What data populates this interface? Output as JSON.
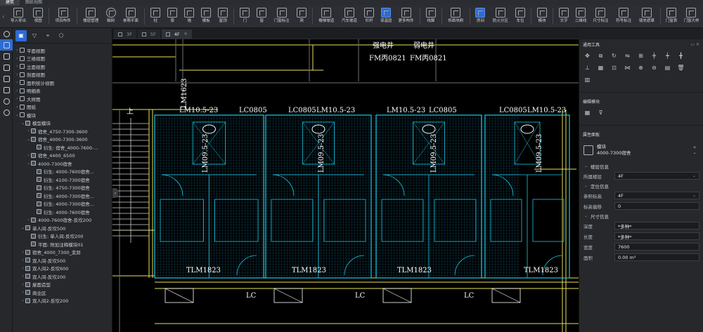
{
  "ribbon": {
    "tabs": [
      "建筑",
      "图纸视图"
    ],
    "groups": [
      [
        {
          "label": "导入导出",
          "icon": "import-export-icon",
          "wide": true
        },
        {
          "label": "视图",
          "icon": "view-icon"
        }
      ],
      [
        {
          "label": "项目构件",
          "icon": "project-component-icon",
          "wide": true
        }
      ],
      [
        {
          "label": "楼层管理",
          "icon": "floor-manage-icon",
          "wide": true
        },
        {
          "label": "轴网",
          "icon": "axis-grid-icon",
          "round": true
        },
        {
          "label": "参照平面",
          "icon": "reference-plane-icon",
          "wide": true
        }
      ],
      [
        {
          "label": "柱",
          "icon": "column-icon"
        },
        {
          "label": "梁",
          "icon": "beam-icon"
        },
        {
          "label": "墙",
          "icon": "wall-icon"
        },
        {
          "label": "楼板",
          "icon": "slab-icon"
        },
        {
          "label": "屋顶",
          "icon": "roof-icon"
        }
      ],
      [
        {
          "label": "门",
          "icon": "door-icon"
        },
        {
          "label": "窗",
          "icon": "window-icon"
        },
        {
          "label": "门窗标注",
          "icon": "door-window-tag-icon",
          "wide": true
        },
        {
          "label": "洞",
          "icon": "opening-icon"
        }
      ],
      [
        {
          "label": "楼梯坡道",
          "icon": "stair-ramp-icon",
          "wide": true
        },
        {
          "label": "汽车坡道",
          "icon": "car-ramp-icon",
          "wide": true
        },
        {
          "label": "栏杆",
          "icon": "railing-icon"
        },
        {
          "label": "保温层",
          "icon": "insulation-icon",
          "blue": true
        },
        {
          "label": "更多构件",
          "icon": "more-components-icon",
          "wide": true
        }
      ],
      [
        {
          "label": "线脚",
          "icon": "molding-icon"
        }
      ],
      [
        {
          "label": "饰面块刷",
          "icon": "finish-brush-icon",
          "wide": true
        }
      ],
      [
        {
          "label": "房间",
          "icon": "room-icon",
          "blue": true
        },
        {
          "label": "防火分区",
          "icon": "fire-zone-icon",
          "wide": true
        },
        {
          "label": "车位",
          "icon": "parking-icon"
        }
      ],
      [
        {
          "label": "模块",
          "icon": "module-icon"
        }
      ],
      [
        {
          "label": "文字",
          "icon": "text-icon"
        },
        {
          "label": "二维线",
          "icon": "2d-line-icon"
        },
        {
          "label": "尺寸标注",
          "icon": "dimension-icon",
          "wide": true
        },
        {
          "label": "符号标注",
          "icon": "symbol-tag-icon",
          "wide": true
        },
        {
          "label": "填充遮罩",
          "icon": "fill-mask-icon",
          "wide": true
        }
      ],
      [
        {
          "label": "门窗表",
          "icon": "door-window-table-icon"
        },
        {
          "label": "门窗大样",
          "icon": "door-window-detail-icon",
          "wide": true
        }
      ]
    ]
  },
  "left_panel": {
    "tools": [
      "panel-icon",
      "filter-icon",
      "locate-icon",
      "settings-icon"
    ],
    "tree": [
      {
        "d": 0,
        "t": "平面视图",
        "tw": "›"
      },
      {
        "d": 0,
        "t": "三维视图",
        "tw": "›"
      },
      {
        "d": 0,
        "t": "立面视图",
        "tw": "›"
      },
      {
        "d": 0,
        "t": "剖面视图",
        "tw": "›"
      },
      {
        "d": 0,
        "t": "面积统计视图",
        "tw": "›"
      },
      {
        "d": 0,
        "t": "明细表",
        "tw": "›"
      },
      {
        "d": 0,
        "t": "大样图",
        "tw": "›"
      },
      {
        "d": 0,
        "t": "图纸",
        "tw": "›"
      },
      {
        "d": 0,
        "t": "模块",
        "tw": "⌄"
      },
      {
        "d": 1,
        "t": "模型模块",
        "tw": "⌄"
      },
      {
        "d": 2,
        "t": "宿舍_4750-7300-3600",
        "tw": "›"
      },
      {
        "d": 2,
        "t": "宿舍_4000-7300-3600",
        "tw": "⌄"
      },
      {
        "d": 3,
        "t": "衍生: 宿舍_4000-7600-...",
        "tw": ""
      },
      {
        "d": 2,
        "t": "宿舍_4400_6500",
        "tw": "›"
      },
      {
        "d": 2,
        "t": "4000-7300宿舍",
        "tw": "⌄"
      },
      {
        "d": 3,
        "t": "衍生: 4000-7600宿舍...",
        "tw": ""
      },
      {
        "d": 3,
        "t": "衍生: 4100-7300宿舍",
        "tw": ""
      },
      {
        "d": 3,
        "t": "衍生: 4750-7300宿舍",
        "tw": ""
      },
      {
        "d": 3,
        "t": "衍生: 4000-7300宿舍...",
        "tw": ""
      },
      {
        "d": 3,
        "t": "衍生: 4000-7300宿舍...",
        "tw": ""
      },
      {
        "d": 3,
        "t": "衍生: 4000-7600宿舍",
        "tw": ""
      },
      {
        "d": 2,
        "t": "4000-7600宿舍-反坎200",
        "tw": "›"
      },
      {
        "d": 1,
        "t": "单人间-反坎500",
        "tw": "⌄"
      },
      {
        "d": 2,
        "t": "衍生: 单人间-反坎200",
        "tw": ""
      },
      {
        "d": 2,
        "t": "平面: 附加注释模块01",
        "tw": ""
      },
      {
        "d": 1,
        "t": "宿舍_4000_7300_变异",
        "tw": "›"
      },
      {
        "d": 1,
        "t": "双人间-反坎500",
        "tw": "›"
      },
      {
        "d": 1,
        "t": "双人间2-反坎600",
        "tw": "›"
      },
      {
        "d": 1,
        "t": "双人间-反坎200",
        "tw": "›"
      },
      {
        "d": 1,
        "t": "屋面造型",
        "tw": "›"
      },
      {
        "d": 1,
        "t": "商业区",
        "tw": "›"
      },
      {
        "d": 1,
        "t": "双人间2-反坎200",
        "tw": "›"
      }
    ]
  },
  "doc_tabs": [
    {
      "label": "3F",
      "active": false
    },
    {
      "label": "5F",
      "active": false
    },
    {
      "label": "4F",
      "active": true
    }
  ],
  "canvas": {
    "labels_top": [
      "LM10.5-23",
      "LC0805",
      "LC0805",
      "LM10.5-23",
      "LM10.5-23",
      "LC0805",
      "LC0805",
      "LM10.5-23"
    ],
    "labels_vertical": [
      "LM09.5-23",
      "LM09.5-23",
      "LM09.5-23",
      "LM09.5-23"
    ],
    "labels_bottom": [
      "TLM1823",
      "TLM1823",
      "TLM1823",
      "TLM1823"
    ],
    "fm_labels": [
      "FM丙0821",
      "FM丙0821"
    ],
    "room_labels": [
      "强电井",
      "弱电井"
    ],
    "side_label": "LM1623",
    "stair_mark": "上",
    "cross_mark": "LC"
  },
  "right_panel": {
    "common_tools_title": "通用工具",
    "module_edit_title": "编辑模块",
    "props_title": "属性面板",
    "prop_card": {
      "line1": "模块",
      "line2": "4000-7300宿舍"
    },
    "sec_floor": "楼层信息",
    "floor_label": "所属楼层",
    "floor_value": "4F",
    "sec_position": "定位信息",
    "ref_elev_label": "参照标高",
    "ref_elev_value": "4F",
    "offset_label": "标高偏移",
    "offset_value": "0",
    "sec_size": "尺寸信息",
    "depth_label": "深度",
    "depth_value": "*多种*",
    "length_label": "长度",
    "length_value": "*多种*",
    "width_label": "宽度",
    "width_value": "7600",
    "area_label": "面积",
    "area_value": "0.00 m²"
  },
  "colors": {
    "accent": "#2d6bd6",
    "cad_cyan": "#19c8e6",
    "cad_yellow": "#e8e05a",
    "cad_white": "#ffffff",
    "panel_bg": "#26282c"
  }
}
